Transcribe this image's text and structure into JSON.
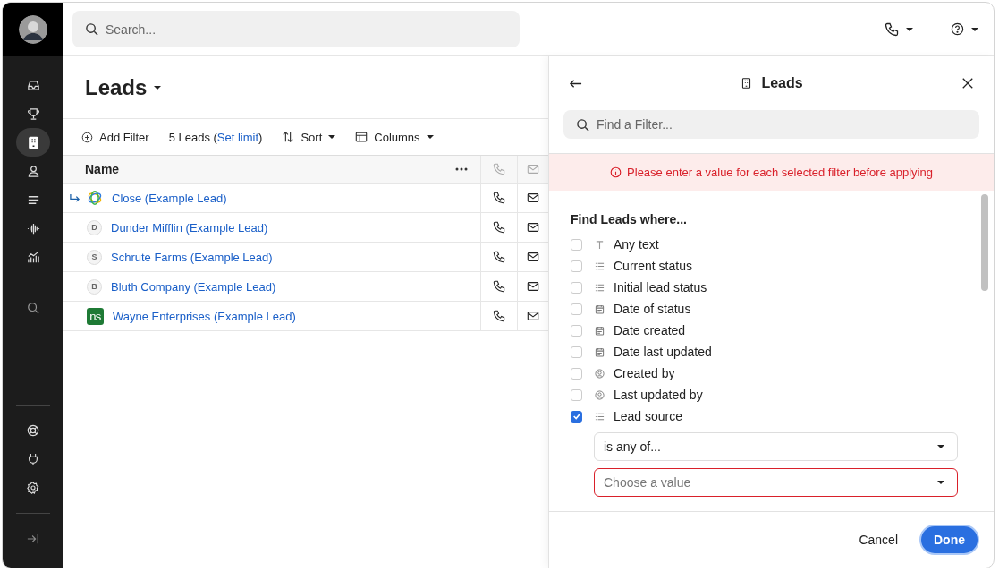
{
  "sidebar": {
    "nav": [
      {
        "kind": "inbox",
        "selected": false
      },
      {
        "kind": "trophy",
        "selected": false
      },
      {
        "kind": "building",
        "selected": true
      },
      {
        "kind": "person",
        "selected": false
      },
      {
        "kind": "lines",
        "selected": false
      },
      {
        "kind": "wave",
        "selected": false
      },
      {
        "kind": "chart",
        "selected": false
      }
    ],
    "bottom": [
      {
        "kind": "lifebuoy"
      },
      {
        "kind": "plug"
      },
      {
        "kind": "gear"
      }
    ]
  },
  "topbar": {
    "search": {
      "placeholder": "Search..."
    }
  },
  "main": {
    "title": "Leads",
    "toolbar": {
      "add_filter": "Add Filter",
      "count": "5 Leads (",
      "limit_link": "Set limit",
      "count_end": ")",
      "sort": "Sort",
      "columns": "Columns"
    },
    "table": {
      "columns": [
        "Name"
      ],
      "rows": [
        {
          "name": "Close (Example Lead)",
          "kind": "logo",
          "highlighted": true
        },
        {
          "name": "Dunder Mifflin (Example Lead)",
          "kind": "letter",
          "letter": "D",
          "highlighted": false
        },
        {
          "name": "Schrute Farms (Example Lead)",
          "kind": "letter",
          "letter": "S",
          "highlighted": false
        },
        {
          "name": "Bluth Company (Example Lead)",
          "kind": "letter",
          "letter": "B",
          "highlighted": false
        },
        {
          "name": "Wayne Enterprises (Example Lead)",
          "kind": "square",
          "letter": "ns",
          "highlighted": false
        }
      ]
    }
  },
  "panel": {
    "title": "Leads",
    "search": {
      "placeholder": "Find a Filter..."
    },
    "error": "Please enter a value for each selected filter before applying",
    "heading": "Find Leads where...",
    "filters": [
      {
        "label": "Any text",
        "kind": "text",
        "checked": false
      },
      {
        "label": "Current status",
        "kind": "list",
        "checked": false
      },
      {
        "label": "Initial lead status",
        "kind": "list",
        "checked": false
      },
      {
        "label": "Date of status",
        "kind": "date",
        "checked": false
      },
      {
        "label": "Date created",
        "kind": "date",
        "checked": false
      },
      {
        "label": "Date last updated",
        "kind": "date",
        "checked": false
      },
      {
        "label": "Created by",
        "kind": "user",
        "checked": false
      },
      {
        "label": "Last updated by",
        "kind": "user",
        "checked": false
      },
      {
        "label": "Lead source",
        "kind": "list",
        "checked": true,
        "operator": "is any of...",
        "value": {
          "placeholder": "Choose a value",
          "invalid": true
        }
      }
    ],
    "buttons": {
      "cancel": "Cancel",
      "done": "Done"
    }
  }
}
